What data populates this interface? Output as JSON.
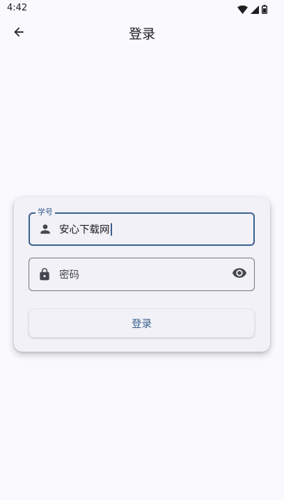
{
  "status_bar": {
    "time": "4:42",
    "icons": [
      "wifi-icon",
      "signal-icon",
      "battery-icon"
    ]
  },
  "app_bar": {
    "back_icon": "arrow-back-icon",
    "title": "登录"
  },
  "login_form": {
    "username": {
      "label": "学号",
      "value": "安心下载网",
      "icon": "person-icon"
    },
    "password": {
      "placeholder": "密码",
      "icon": "lock-icon",
      "toggle_icon": "eye-icon"
    },
    "submit_label": "登录"
  },
  "colors": {
    "primary": "#3b5f8d",
    "background": "#f9f9fe",
    "card": "#f1f1f7",
    "icon": "#44474e"
  }
}
